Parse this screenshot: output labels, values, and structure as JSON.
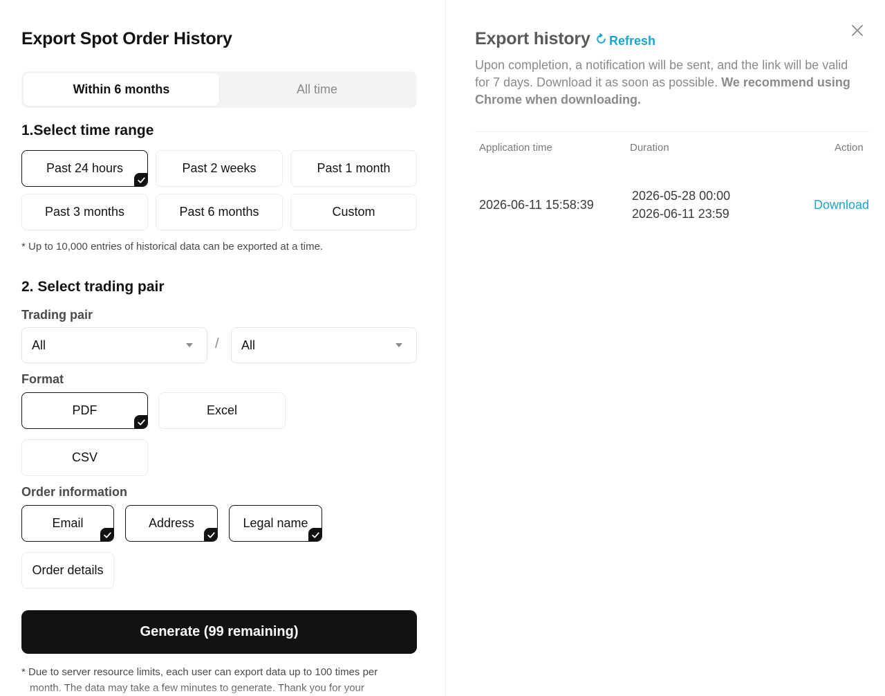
{
  "dialog": {
    "title": "Export Spot Order History",
    "tabs": [
      {
        "label": "Within 6 months",
        "active": true
      },
      {
        "label": "All time",
        "active": false
      }
    ],
    "time_range": {
      "title": "1.Select time range",
      "options": [
        "Past 24 hours",
        "Past 2 weeks",
        "Past 1 month",
        "Past 3 months",
        "Past 6 months",
        "Custom"
      ],
      "selected": "Past 24 hours",
      "note": "* Up to 10,000 entries of historical data can be exported at a time."
    },
    "trading_pair": {
      "title": "2. Select trading pair",
      "label": "Trading pair",
      "base_value": "All",
      "quote_value": "All",
      "separator": "/"
    },
    "format": {
      "label": "Format",
      "options": [
        "PDF",
        "Excel",
        "CSV"
      ],
      "selected": "PDF"
    },
    "order_information": {
      "label": "Order information",
      "options": [
        "Email",
        "Address",
        "Legal name",
        "Order details"
      ],
      "checked": [
        "Email",
        "Address",
        "Legal name"
      ]
    },
    "generate_label": "Generate (99 remaining)",
    "footer_note_line1": "* Due to server resource limits, each user can export data up to 100 times per",
    "footer_note_line2": "month. The data may take a few minutes to generate. Thank you for your"
  },
  "history": {
    "title": "Export history",
    "refresh_label": "Refresh",
    "desc_plain": "Upon completion, a notification will be sent, and the link will be valid for 7 days. Download it as soon as possible. ",
    "desc_bold": "We recommend using Chrome when downloading.",
    "columns": [
      "Application time",
      "Duration",
      "Action"
    ],
    "rows": [
      {
        "application_time": "2026-06-11 15:58:39",
        "duration_start": "2026-05-28 00:00",
        "duration_end": "2026-06-11 23:59",
        "action": "Download"
      }
    ]
  },
  "colors": {
    "accent": "#1aa7c9",
    "primary": "#121212",
    "muted": "#8a8a8a"
  },
  "icons": [
    "check-icon",
    "refresh-icon",
    "close-icon",
    "caret-down-icon"
  ]
}
